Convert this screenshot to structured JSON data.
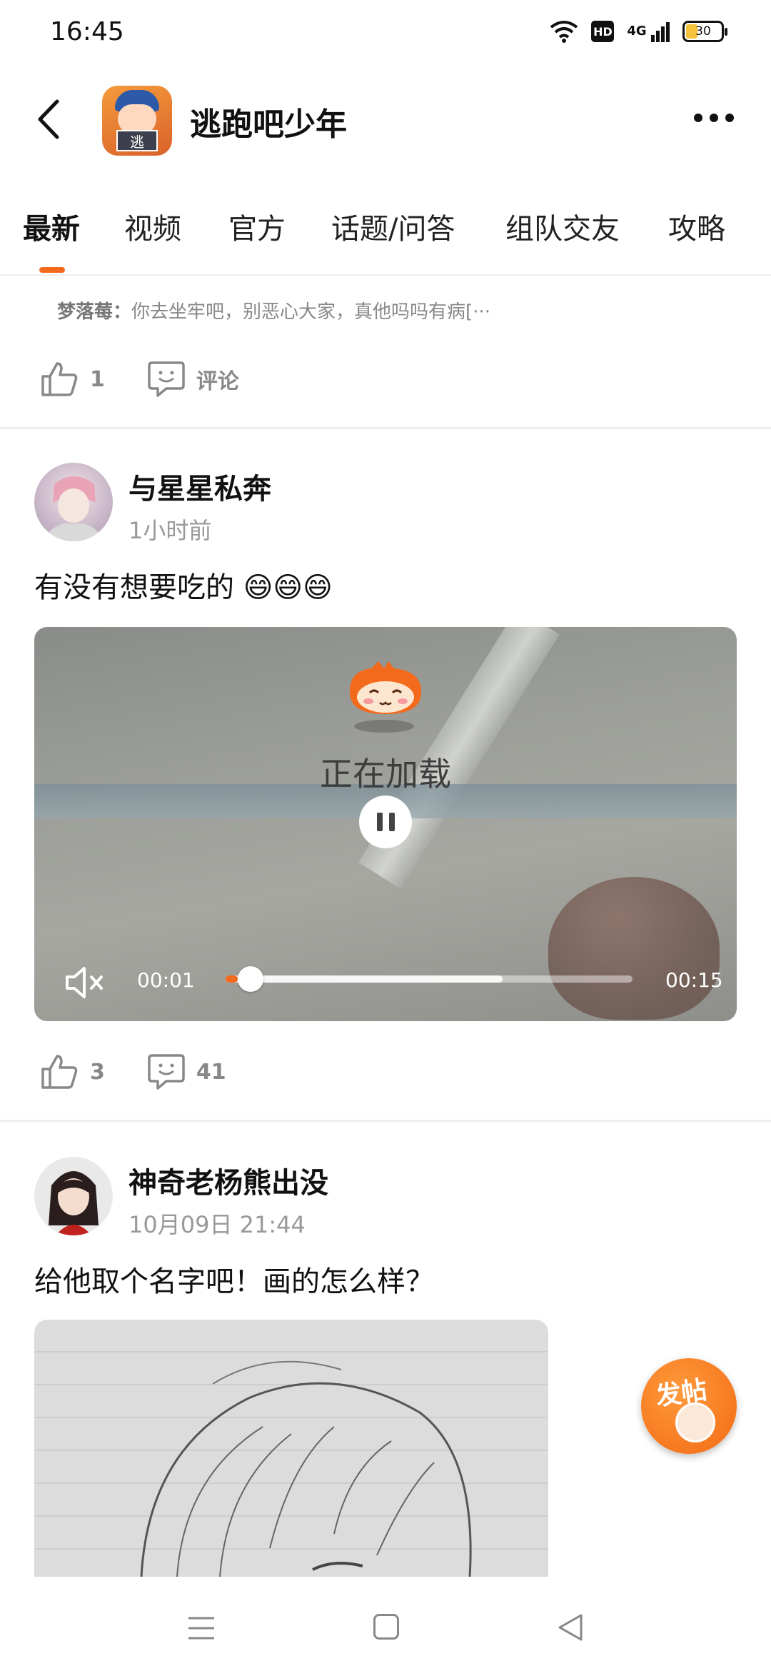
{
  "status_bar": {
    "time": "16:45",
    "hd": "HD",
    "network": "4G",
    "battery": "30"
  },
  "header": {
    "title": "逃跑吧少年",
    "logo_text": "逃"
  },
  "tabs": [
    {
      "label": "最新",
      "active": true
    },
    {
      "label": "视频"
    },
    {
      "label": "官方"
    },
    {
      "label": "话题/问答"
    },
    {
      "label": "组队交友"
    },
    {
      "label": "攻略"
    }
  ],
  "prev_post": {
    "comment_author": "梦落莓：",
    "comment_text": "你去坐牢吧，别恶心大家，真他吗吗有病[···",
    "likes": "1",
    "comment_label": "评论"
  },
  "post1": {
    "username": "与星星私奔",
    "time": "1小时前",
    "text": "有没有想要吃的 😄😄😄",
    "video": {
      "loading_text": "正在加载",
      "current_time": "00:01",
      "total_time": "00:15",
      "progress": 0.03,
      "buffered": 0.68
    },
    "likes": "3",
    "comments": "41"
  },
  "post2": {
    "username": "神奇老杨熊出没",
    "time": "10月09日 21:44",
    "text": "给他取个名字吧！画的怎么样？"
  },
  "fab": {
    "label": "发帖"
  },
  "colors": {
    "accent": "#f46a1c"
  }
}
